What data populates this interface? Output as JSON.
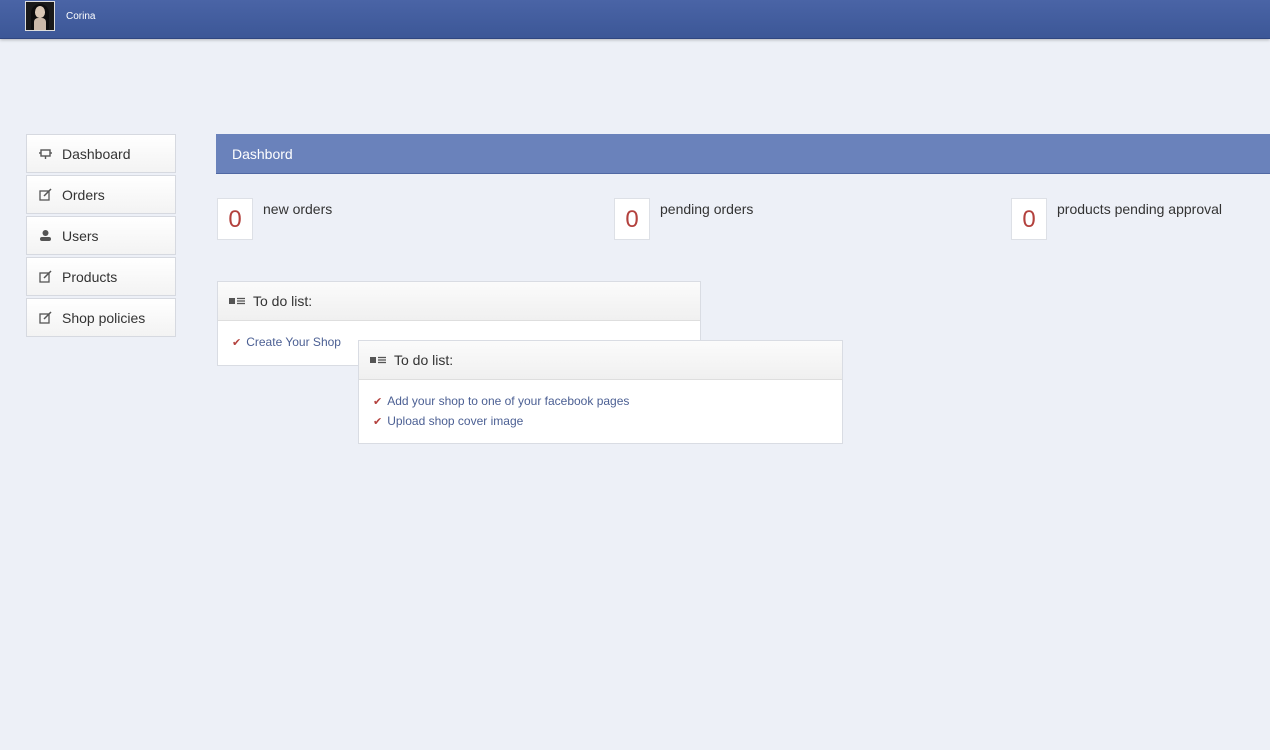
{
  "topbar": {
    "username": "Corina",
    "avatar_icon": "user-avatar-photo"
  },
  "sidebar": {
    "items": [
      {
        "label": "Dashboard",
        "icon": "dashboard-icon"
      },
      {
        "label": "Orders",
        "icon": "edit-icon"
      },
      {
        "label": "Users",
        "icon": "user-icon"
      },
      {
        "label": "Products",
        "icon": "edit-icon"
      },
      {
        "label": "Shop policies",
        "icon": "edit-icon"
      }
    ]
  },
  "main": {
    "title": "Dashbord"
  },
  "stats": [
    {
      "value": "0",
      "label": "new orders"
    },
    {
      "value": "0",
      "label": "pending orders"
    },
    {
      "value": "0",
      "label": "products pending approval"
    }
  ],
  "todo_panels": [
    {
      "title": "To do list:",
      "items": [
        "Create Your Shop"
      ]
    },
    {
      "title": "To do list:",
      "items": [
        "Add your shop to one of your facebook pages",
        "Upload shop cover image"
      ]
    }
  ],
  "colors": {
    "topbar": "#3c5797",
    "header": "#6a82bb",
    "background": "#edf0f7",
    "stat_value": "#b3413d",
    "link": "#4b5f93",
    "check": "#b3413d"
  }
}
